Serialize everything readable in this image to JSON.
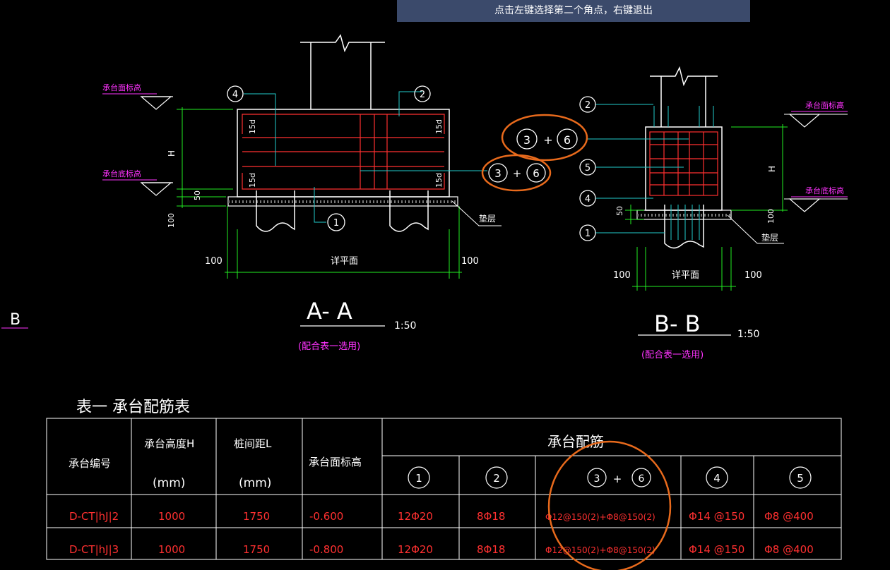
{
  "prompt": "点击左键选择第二个角点，右键退出",
  "margin_letter": "B",
  "section_aa": {
    "title": "A- A",
    "scale": "1:50",
    "note": "(配合表一选用)",
    "top_label": "承台面标高",
    "bottom_label": "承台底标高",
    "dim_h": "H",
    "dim_50": "50",
    "dim_100": "100",
    "hook_top_left": "15d",
    "hook_top_right": "15d",
    "hook_bottom_left": "15d",
    "hook_bottom_right": "15d",
    "cushion": "垫层",
    "width_label": "详平面",
    "side_left": "100",
    "side_right": "100",
    "callouts": [
      "4",
      "2",
      "3",
      "6",
      "1"
    ]
  },
  "section_bb": {
    "title": "B- B",
    "scale": "1:50",
    "note": "(配合表一选用)",
    "top_label": "承台面标高",
    "bottom_label": "承台底标高",
    "dim_h": "H",
    "dim_50": "50",
    "dim_100": "100",
    "cushion": "垫层",
    "width_label": "详平面",
    "side_left": "100",
    "side_right": "100",
    "callouts": [
      "2",
      "3",
      "6",
      "5",
      "4",
      "1"
    ]
  },
  "table": {
    "title": "表一  承台配筋表",
    "headers": {
      "id": "承台编号",
      "height": "承台高度H",
      "height_unit": "(mm)",
      "spacing": "桩间距L",
      "spacing_unit": "(mm)",
      "elevation": "承台面标高",
      "rebar": "承台配筋",
      "sub": [
        "1",
        "2",
        "3",
        "6",
        "4",
        "5"
      ]
    },
    "rows": [
      {
        "id": "D-CT|hJ|2",
        "h": "1000",
        "l": "1750",
        "elev": "-0.600",
        "r1": "12Φ20",
        "r2": "8Φ18",
        "r36": "Φ12@150(2)+Φ8@150(2)",
        "r4": "Φ14 @150",
        "r5": "Φ8 @400"
      },
      {
        "id": "D-CT|hJ|3",
        "h": "1000",
        "l": "1750",
        "elev": "-0.800",
        "r1": "12Φ20",
        "r2": "8Φ18",
        "r36": "Φ12@150(2)+Φ8@150(2)",
        "r4": "Φ14 @150",
        "r5": "Φ8 @400"
      }
    ]
  },
  "colors": {
    "background": "#000000",
    "outline": "#ffffff",
    "rebar": "#ff3030",
    "dimension": "#22ee22",
    "leader": "#22cccc",
    "annotation": "#ff33ff",
    "markup": "#e86a1c"
  }
}
